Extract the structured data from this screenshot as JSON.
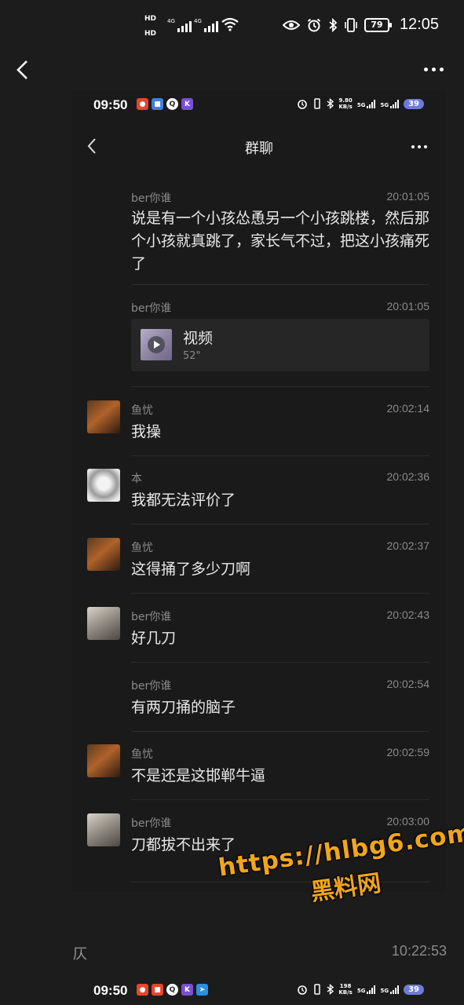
{
  "outer_status": {
    "hd1": "HD",
    "hd2": "HD",
    "net1": "4G",
    "net2": "4G",
    "battery": "79",
    "clock": "12:05"
  },
  "inner_status": {
    "time": "09:50",
    "speed_value": "9.80",
    "speed_unit": "KB/s",
    "net1": "5G",
    "net2": "5G",
    "battery": "39"
  },
  "chat": {
    "title": "群聊"
  },
  "messages": [
    {
      "sender": "ber你谁",
      "time": "20:01:05",
      "text": "说是有一个小孩怂恿另一个小孩跳楼，然后那个小孩就真跳了，家长气不过，把这小孩痛死了"
    },
    {
      "sender": "ber你谁",
      "time": "20:01:05",
      "video_label": "视频",
      "video_duration": "52\""
    },
    {
      "sender": "鱼忧",
      "time": "20:02:14",
      "text": "我操"
    },
    {
      "sender": "本",
      "time": "20:02:36",
      "text": "我都无法评价了"
    },
    {
      "sender": "鱼忧",
      "time": "20:02:37",
      "text": "这得捅了多少刀啊"
    },
    {
      "sender": "ber你谁",
      "time": "20:02:43",
      "text": "好几刀"
    },
    {
      "sender": "ber你谁",
      "time": "20:02:54",
      "text": "有两刀捅的脑子"
    },
    {
      "sender": "鱼忧",
      "time": "20:02:59",
      "text": "不是还是这邯郸牛逼"
    },
    {
      "sender": "ber你谁",
      "time": "20:03:00",
      "text": "刀都拔不出来了"
    }
  ],
  "watermark": {
    "url": "https://hlbg6.com",
    "name": "黑料网"
  },
  "bottom": {
    "sender": "仄",
    "time": "10:22:53",
    "inner_time": "09:50",
    "speed_value": "198",
    "speed_unit": "KB/s",
    "net1": "5G",
    "net2": "5G",
    "battery": "39"
  }
}
